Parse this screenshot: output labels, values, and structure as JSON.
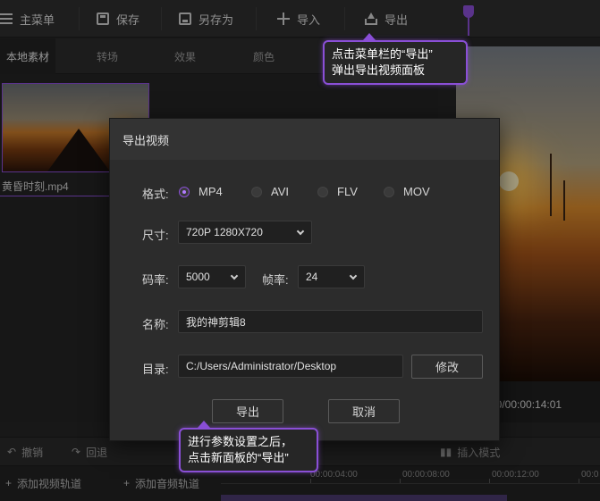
{
  "menubar": {
    "items": [
      {
        "label": "主菜单",
        "icon": "menu-icon"
      },
      {
        "label": "保存",
        "icon": "save-icon"
      },
      {
        "label": "另存为",
        "icon": "save-as-icon"
      },
      {
        "label": "导入",
        "icon": "plus-icon"
      },
      {
        "label": "导出",
        "icon": "export-icon"
      }
    ]
  },
  "tabs": [
    {
      "label": "本地素材",
      "active": true
    },
    {
      "label": "转场"
    },
    {
      "label": "效果"
    },
    {
      "label": "颜色"
    }
  ],
  "media": {
    "file_name": "黄昏时刻.mp4"
  },
  "preview": {
    "time": "00/00:00:14:01"
  },
  "toolbar": {
    "undo_label": "撤销",
    "redo_label": "回退",
    "insert_label": "插入模式"
  },
  "timeline": {
    "add_video_track": "添加视频轨道",
    "add_audio_track": "添加音频轨道",
    "ruler_labels": [
      "00:00:04:00",
      "00:00:08:00",
      "00:00:12:00",
      "00:0"
    ]
  },
  "export_dialog": {
    "title": "导出视频",
    "format_label": "格式:",
    "formats": [
      {
        "label": "MP4",
        "selected": true
      },
      {
        "label": "AVI"
      },
      {
        "label": "FLV"
      },
      {
        "label": "MOV"
      }
    ],
    "size_label": "尺寸:",
    "size_value": "720P 1280X720",
    "bitrate_label": "码率:",
    "bitrate_value": "5000",
    "framerate_label": "帧率:",
    "framerate_value": "24",
    "name_label": "名称:",
    "name_value": "我的神剪辑8",
    "dir_label": "目录:",
    "dir_value": "C:/Users/Administrator/Desktop",
    "modify_label": "修改",
    "export_label": "导出",
    "cancel_label": "取消"
  },
  "callouts": {
    "top_line1": "点击菜单栏的“导出”",
    "top_line2": "弹出导出视频面板",
    "bottom_line1": "进行参数设置之后，",
    "bottom_line2": "点击新面板的“导出”"
  },
  "colors": {
    "accent": "#8a4fd6",
    "background": "#262626",
    "dialog": "#2c2c2c"
  }
}
